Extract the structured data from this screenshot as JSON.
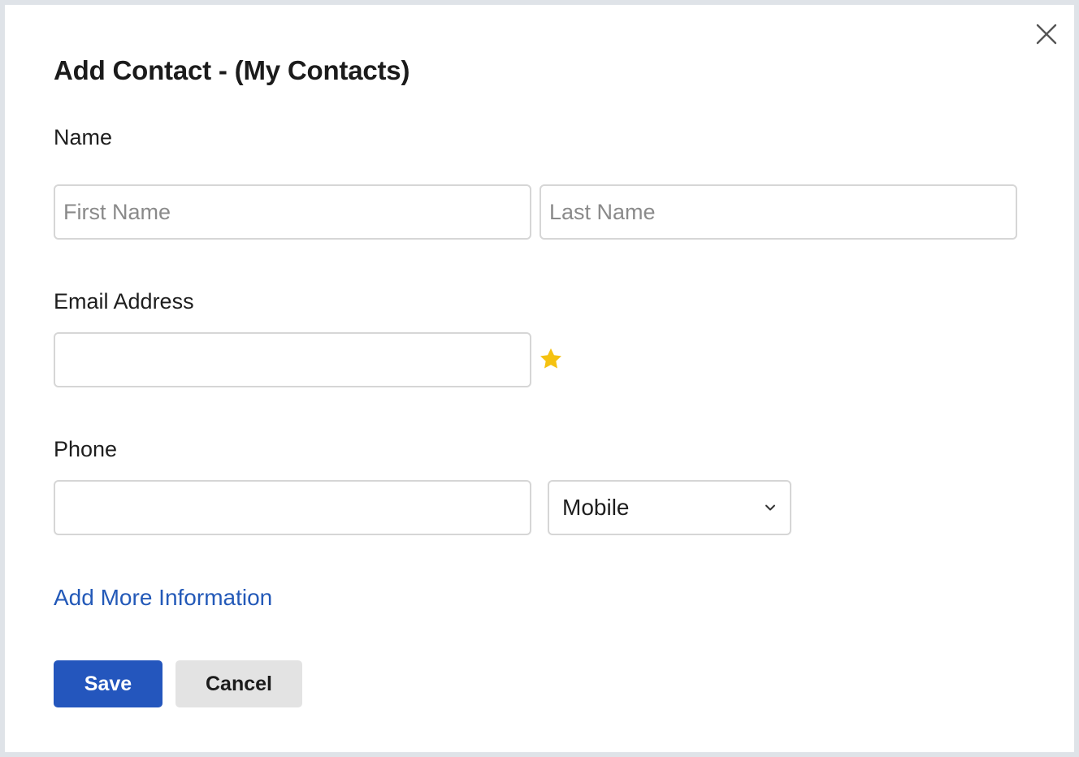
{
  "dialog": {
    "title": "Add Contact - (My Contacts)",
    "close_icon": "close-icon"
  },
  "name": {
    "label": "Name",
    "first_placeholder": "First Name",
    "first_value": "",
    "last_placeholder": "Last Name",
    "last_value": ""
  },
  "email": {
    "label": "Email Address",
    "value": "",
    "star_icon": "star-icon",
    "star_color": "#f5c211"
  },
  "phone": {
    "label": "Phone",
    "value": "",
    "type_selected": "Mobile",
    "chevron_icon": "chevron-down-icon"
  },
  "more_link": {
    "label": "Add More Information",
    "color": "#2359b8"
  },
  "actions": {
    "save_label": "Save",
    "cancel_label": "Cancel",
    "save_color": "#2456bd",
    "cancel_color": "#e3e3e3"
  }
}
